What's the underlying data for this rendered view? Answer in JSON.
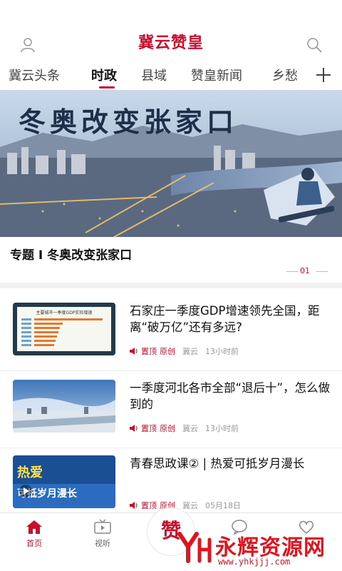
{
  "header": {
    "title": "冀云赞皇",
    "user_icon": "user-icon",
    "search_icon": "search-icon",
    "brand_color": "#c8102e"
  },
  "tabs": [
    {
      "label": "冀云头条",
      "active": false
    },
    {
      "label": "时政",
      "active": true
    },
    {
      "label": "县域",
      "active": false
    },
    {
      "label": "赞皇新闻",
      "active": false
    },
    {
      "label": "乡愁",
      "active": false
    }
  ],
  "tabs_more_icon": "plus-icon",
  "banner": {
    "image_text": "冬奥改变张家口",
    "title": "专题 I 冬奥改变张家口",
    "page_indicator": "01"
  },
  "news": [
    {
      "headline": "石家庄一季度GDP增速领先全国，距离“破万亿”还有多远?",
      "tag": "置顶",
      "tag2": "原创",
      "source": "冀云",
      "time": "13小时前",
      "thumb_caption": "主要城市一季度GDP实际增速"
    },
    {
      "headline": "一季度河北各市全部“退后十”，怎么做到的",
      "tag": "置顶",
      "tag2": "原创",
      "source": "冀云",
      "time": "13小时前"
    },
    {
      "headline": "青春思政课② | 热爱可抵岁月漫长",
      "tag": "置顶",
      "tag2": "原创",
      "source": "冀云",
      "time": "05月18日",
      "thumb_text_1": "热爱",
      "thumb_text_2": "可抵岁月漫长"
    }
  ],
  "bottom_nav": [
    {
      "label": "首页",
      "icon": "home-icon",
      "active": true
    },
    {
      "label": "视听",
      "icon": "tv-icon",
      "active": false
    },
    {
      "label": "",
      "icon": "center-logo",
      "active": false
    },
    {
      "label": "",
      "icon": "chat-icon",
      "active": false
    },
    {
      "label": "",
      "icon": "heart-icon",
      "active": false
    }
  ],
  "center_logo_text": "赞",
  "watermark": {
    "text": "永辉资源网",
    "url": "www.yhkjjj.com"
  }
}
